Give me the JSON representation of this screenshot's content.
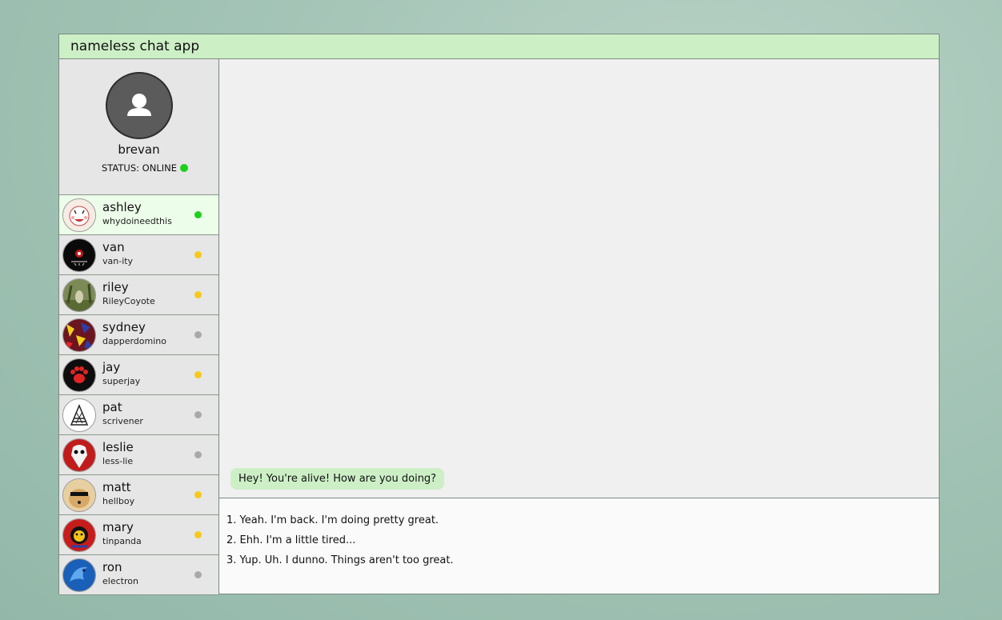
{
  "app": {
    "title": "nameless chat app"
  },
  "profile": {
    "name": "brevan",
    "status_text": "STATUS: ONLINE",
    "status": "online",
    "avatar_icon": "user-icon"
  },
  "status_colors": {
    "online": "#1bd11b",
    "away": "#f6c81b",
    "offline": "#a9a9a9"
  },
  "contacts": [
    {
      "name": "ashley",
      "handle": "whydoineedthis",
      "status": "online",
      "active": true
    },
    {
      "name": "van",
      "handle": "van-ity",
      "status": "away"
    },
    {
      "name": "riley",
      "handle": "RileyCoyote",
      "status": "away"
    },
    {
      "name": "sydney",
      "handle": "dapperdomino",
      "status": "offline"
    },
    {
      "name": "jay",
      "handle": "superjay",
      "status": "away"
    },
    {
      "name": "pat",
      "handle": "scrivener",
      "status": "offline"
    },
    {
      "name": "leslie",
      "handle": "less-lie",
      "status": "offline"
    },
    {
      "name": "matt",
      "handle": "hellboy",
      "status": "away"
    },
    {
      "name": "mary",
      "handle": "tinpanda",
      "status": "away"
    },
    {
      "name": "ron",
      "handle": "electron",
      "status": "offline"
    }
  ],
  "messages": [
    {
      "from": "ashley",
      "text": "Hey! You're alive! How are you doing?"
    }
  ],
  "replies": [
    "1. Yeah. I'm back. I'm doing pretty great.",
    "2. Ehh. I'm a little tired...",
    "3. Yup. Uh. I dunno. Things aren't too great."
  ]
}
